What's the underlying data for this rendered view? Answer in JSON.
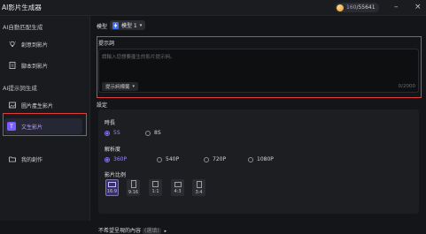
{
  "app": {
    "title": "AI影片生成器",
    "credits_used": "160",
    "credits_sep": "/",
    "credits_total": "55641"
  },
  "sidebar": {
    "section1": "AI自動匹配生成",
    "section2": "AI提示詞生成",
    "items": [
      {
        "label": "創意到影片",
        "icon": "bulb-icon"
      },
      {
        "label": "腳本到影片",
        "icon": "script-icon"
      },
      {
        "label": "圖片產生影片",
        "icon": "image-icon"
      },
      {
        "label": "文生影片",
        "icon": "text-to-video-icon"
      },
      {
        "label": "我的創作",
        "icon": "folder-icon"
      }
    ],
    "active_color": "#7b5cff"
  },
  "main": {
    "model_label": "模型",
    "model_value": "模型 1",
    "prompt_title": "提示詞",
    "prompt_placeholder": "請輸入您想要產生的影片提示詞。",
    "prompt_tags": "提示詞標籤",
    "prompt_count": "0/2000",
    "settings_title": "設定",
    "duration_label": "時長",
    "duration_options": [
      "5S",
      "8S"
    ],
    "duration_selected": "5S",
    "resolution_label": "解析度",
    "resolution_options": [
      "360P",
      "540P",
      "720P",
      "1080P"
    ],
    "resolution_selected": "360P",
    "ratio_label": "影片比例",
    "ratio_options": [
      "16:9",
      "9:16",
      "1:1",
      "4:3",
      "3:4"
    ],
    "ratio_selected": "16:9",
    "negative_label": "不希望呈現的內容",
    "negative_optional": "(選填)"
  },
  "colors": {
    "accent": "#8e6cff",
    "highlight_border": "#e23b3b"
  }
}
